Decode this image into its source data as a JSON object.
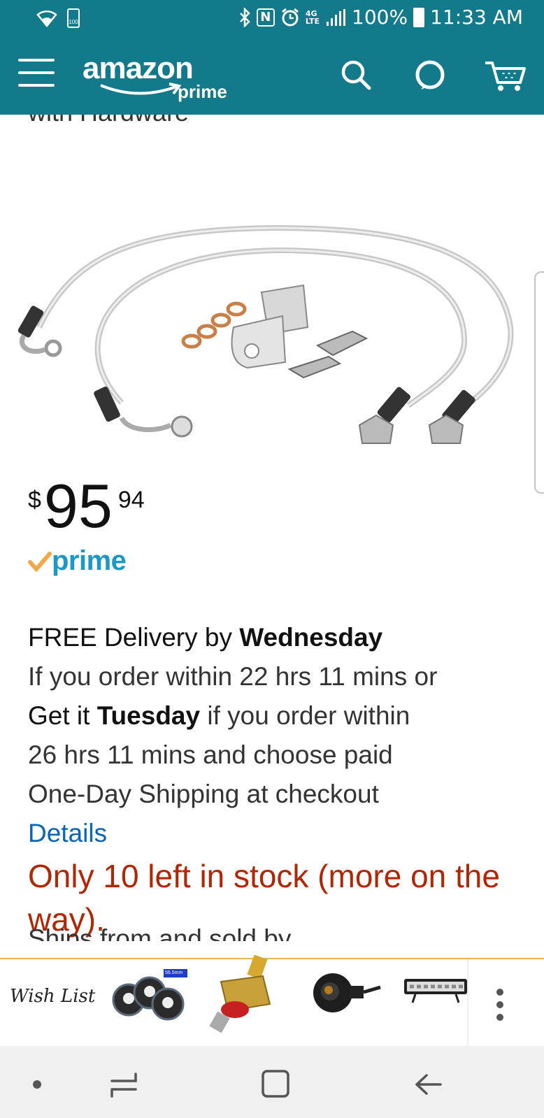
{
  "status_bar": {
    "battery_small_label": "100",
    "lte_label": "4G\nLTE",
    "battery_percent": "100%",
    "time": "11:33 AM"
  },
  "header": {
    "logo_text": "amazon",
    "logo_sub": "prime"
  },
  "product": {
    "title_fragment": "with Hardware",
    "price_symbol": "$",
    "price_whole": "95",
    "price_fraction": "94",
    "prime_label": "prime"
  },
  "delivery": {
    "line1_prefix": "FREE Delivery by ",
    "line1_day": "Wednesday",
    "line2": "If you order within 22 hrs 11 mins or",
    "line3_prefix": "Get it ",
    "line3_day": "Tuesday",
    "line3_suffix": " if you order within",
    "line4": "26 hrs 11 mins and choose paid",
    "line5": "One-Day Shipping at checkout",
    "details_link": "Details",
    "stock": "Only 10 left in stock (more on the way).",
    "ships_fragment": "Ships from and sold by"
  },
  "shelf": {
    "wish_list_label": "Wish List",
    "thumb1_badge": "56.5mm"
  },
  "colors": {
    "header_teal": "#127a8a",
    "stock_red": "#b12704",
    "link_blue": "#0a66b4",
    "prime_blue": "#1a98c8",
    "prime_check": "#f3a847"
  }
}
